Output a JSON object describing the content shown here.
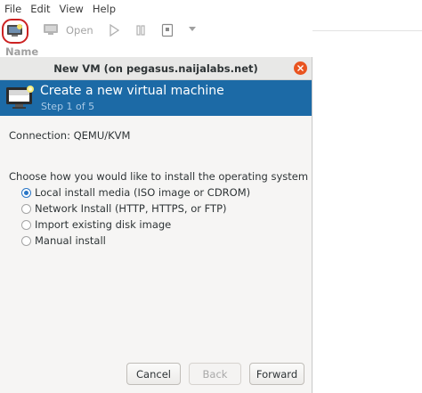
{
  "menu": [
    "File",
    "Edit",
    "View",
    "Help"
  ],
  "toolbar": {
    "open_label": "Open"
  },
  "list": {
    "column_name": "Name"
  },
  "dialog": {
    "title": "New VM (on pegasus.naijalabs.net)",
    "banner_title": "Create a new virtual machine",
    "banner_step": "Step 1 of 5",
    "connection": "Connection: QEMU/KVM",
    "prompt": "Choose how you would like to install the operating system",
    "options": [
      {
        "label": "Local install media (ISO image or CDROM)",
        "selected": true
      },
      {
        "label": "Network Install (HTTP, HTTPS, or FTP)",
        "selected": false
      },
      {
        "label": "Import existing disk image",
        "selected": false
      },
      {
        "label": "Manual install",
        "selected": false
      }
    ],
    "buttons": {
      "cancel": "Cancel",
      "back": "Back",
      "forward": "Forward"
    }
  },
  "colors": {
    "banner": "#1c6aa6",
    "close": "#e95420",
    "highlight": "#cc2222",
    "radio_selected": "#2a76c6"
  },
  "icons": [
    "new-vm-icon",
    "monitor-icon",
    "play-icon",
    "pause-icon",
    "stop-icon",
    "dropdown-arrow-icon",
    "close-icon",
    "vm-banner-icon"
  ]
}
